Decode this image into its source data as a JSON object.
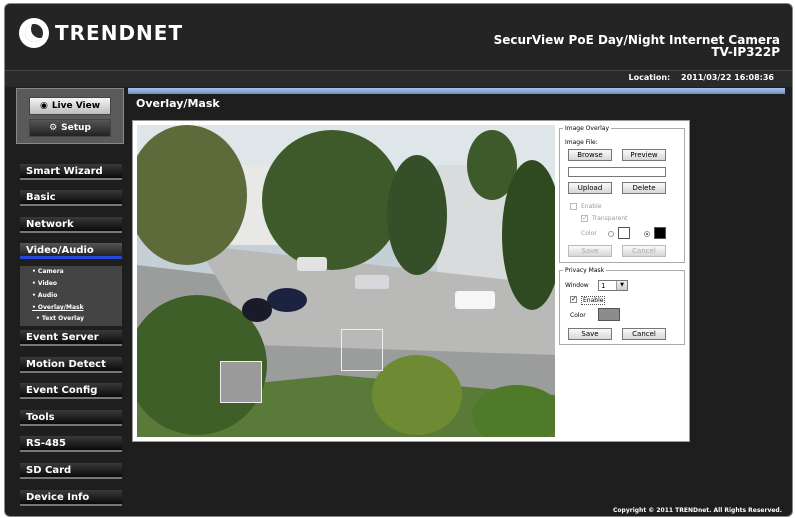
{
  "brand": {
    "name": "TRENDNET"
  },
  "header": {
    "title": "SecurView PoE Day/Night Internet Camera",
    "model": "TV-IP322P"
  },
  "location": {
    "label": "Location:",
    "datetime": "2011/03/22 16:08:36"
  },
  "side_buttons": {
    "live_view": "Live View",
    "setup": "Setup"
  },
  "menu": [
    {
      "label": "Smart Wizard"
    },
    {
      "label": "Basic"
    },
    {
      "label": "Network"
    },
    {
      "label": "Video/Audio"
    },
    {
      "label": "Event Server"
    },
    {
      "label": "Motion Detect"
    },
    {
      "label": "Event Config"
    },
    {
      "label": "Tools"
    },
    {
      "label": "RS-485"
    },
    {
      "label": "SD Card"
    },
    {
      "label": "Device Info"
    }
  ],
  "submenu": {
    "camera": "• Camera",
    "video": "• Video",
    "audio": "• Audio",
    "overlay_mask": "• Overlay/Mask",
    "text_overlay": "• Text Overlay"
  },
  "page": {
    "title": "Overlay/Mask"
  },
  "image_overlay": {
    "legend": "Image Overlay",
    "image_file_label": "Image File:",
    "browse": "Browse",
    "preview": "Preview",
    "upload": "Upload",
    "delete": "Delete",
    "enable": "Enable",
    "transparent": "Transparent",
    "color": "Color",
    "save": "Save",
    "cancel": "Cancel",
    "colors": [
      "#ffffff",
      "#000000"
    ]
  },
  "privacy_mask": {
    "legend": "Privacy Mask",
    "window_label": "Window",
    "window_value": "1",
    "enable": "Enable",
    "color": "Color",
    "save": "Save",
    "cancel": "Cancel",
    "swatch_color": "#8c8c8c"
  },
  "footer": {
    "copyright": "Copyright © 2011 TRENDnet. All Rights Reserved."
  }
}
